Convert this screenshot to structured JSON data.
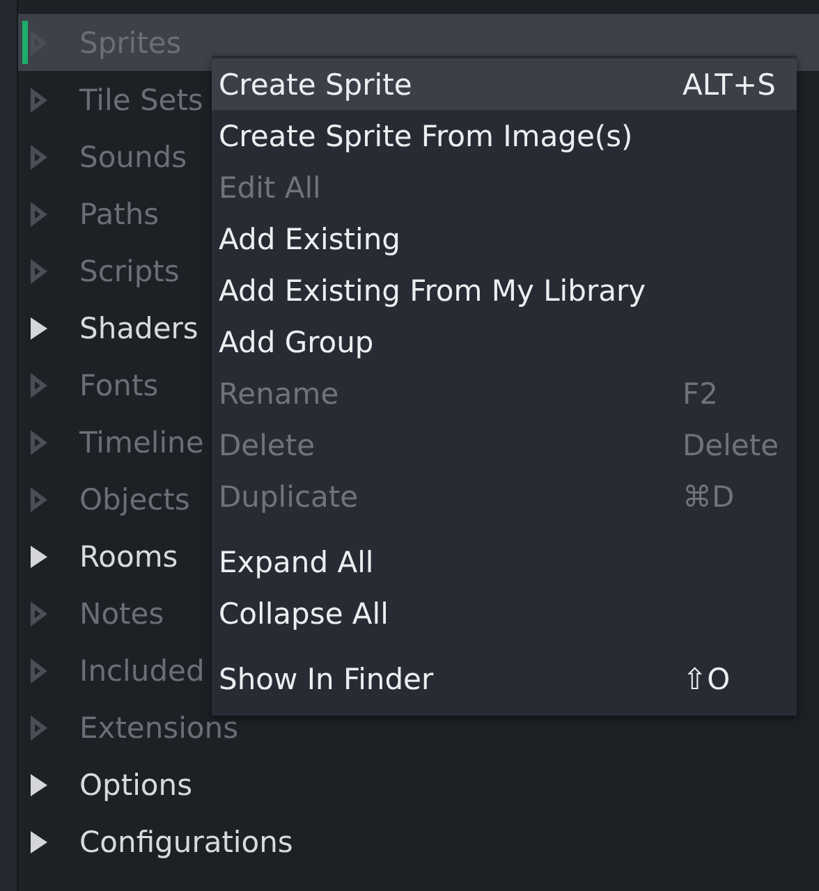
{
  "tree": [
    {
      "label": "Sprites",
      "bright": false,
      "selected": true
    },
    {
      "label": "Tile Sets",
      "bright": false,
      "selected": false
    },
    {
      "label": "Sounds",
      "bright": false,
      "selected": false
    },
    {
      "label": "Paths",
      "bright": false,
      "selected": false
    },
    {
      "label": "Scripts",
      "bright": false,
      "selected": false
    },
    {
      "label": "Shaders",
      "bright": true,
      "selected": false
    },
    {
      "label": "Fonts",
      "bright": false,
      "selected": false
    },
    {
      "label": "Timeline",
      "bright": false,
      "selected": false
    },
    {
      "label": "Objects",
      "bright": false,
      "selected": false
    },
    {
      "label": "Rooms",
      "bright": true,
      "selected": false
    },
    {
      "label": "Notes",
      "bright": false,
      "selected": false
    },
    {
      "label": "Included",
      "bright": false,
      "selected": false
    },
    {
      "label": "Extensions",
      "bright": false,
      "selected": false
    },
    {
      "label": "Options",
      "bright": true,
      "selected": false
    },
    {
      "label": "Configurations",
      "bright": true,
      "selected": false
    }
  ],
  "context_menu": [
    {
      "kind": "item",
      "label": "Create Sprite",
      "shortcut": "ALT+S",
      "disabled": false,
      "selected": true
    },
    {
      "kind": "item",
      "label": "Create Sprite From Image(s)",
      "disabled": false,
      "selected": false
    },
    {
      "kind": "item",
      "label": "Edit All",
      "disabled": true,
      "selected": false
    },
    {
      "kind": "item",
      "label": "Add Existing",
      "disabled": false,
      "selected": false
    },
    {
      "kind": "item",
      "label": "Add Existing From My Library",
      "disabled": false,
      "selected": false
    },
    {
      "kind": "item",
      "label": "Add Group",
      "disabled": false,
      "selected": false
    },
    {
      "kind": "item",
      "label": "Rename",
      "shortcut": "F2",
      "disabled": true,
      "selected": false
    },
    {
      "kind": "item",
      "label": "Delete",
      "shortcut": "Delete",
      "disabled": true,
      "selected": false
    },
    {
      "kind": "item",
      "label": "Duplicate",
      "shortcut": "⌘D",
      "disabled": true,
      "selected": false
    },
    {
      "kind": "separator"
    },
    {
      "kind": "item",
      "label": "Expand All",
      "disabled": false,
      "selected": false
    },
    {
      "kind": "item",
      "label": "Collapse All",
      "disabled": false,
      "selected": false
    },
    {
      "kind": "separator"
    },
    {
      "kind": "item",
      "label": "Show In Finder",
      "shortcut": "⇧O",
      "disabled": false,
      "selected": false
    }
  ]
}
